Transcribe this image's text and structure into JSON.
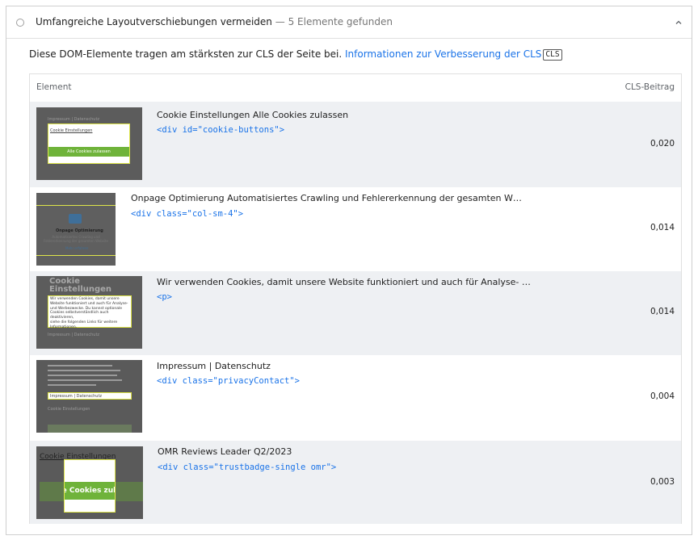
{
  "header": {
    "title": "Umfangreiche Layoutverschiebungen vermeiden",
    "separator": "—",
    "count": "5 Elemente gefunden"
  },
  "description": {
    "text": "Diese DOM-Elemente tragen am stärksten zur CLS der Seite bei.",
    "link": "Informationen zur Verbesserung der CLS",
    "badge": "CLS"
  },
  "table": {
    "col_element": "Element",
    "col_cls": "CLS-Beitrag",
    "rows": [
      {
        "label": "Cookie Einstellungen Alle Cookies zulassen",
        "snippet": "<div id=\"cookie-buttons\">",
        "value": "0,020",
        "thumb": {
          "text1": "Impressum | Datenschutz",
          "text2": "Cookie Einstellungen",
          "button": "Alle Cookies zulassen"
        }
      },
      {
        "label": "Onpage Optimierung Automatisiertes Crawling und Fehlererkennung der gesamten W…",
        "snippet": "<div class=\"col-sm-4\">",
        "value": "0,014",
        "thumb": {
          "text1": "Onpage Optimierung",
          "text2": "Automatisiertes Crawling und Fehlererkennung der gesamten Website",
          "link": "Mehr erfahren"
        }
      },
      {
        "label": "Wir verwenden Cookies, damit unsere Website funktioniert und auch für Analyse- …",
        "snippet": "<p>",
        "value": "0,014",
        "thumb": {
          "heading": "Cookie Einstellungen",
          "body": [
            "Wir verwenden Cookies, damit unsere",
            "Website funktioniert und auch für Analyse-",
            "und Werbezwecke. Du kannst optionale",
            "Cookies selbstverständlich auch deaktivieren,",
            "siehe die folgenden Links für weitere",
            "Informationen."
          ],
          "footer": "Impressum | Datenschutz"
        }
      },
      {
        "label": "Impressum | Datenschutz",
        "snippet": "<div class=\"privacyContact\">",
        "value": "0,004",
        "thumb": {
          "text1": "Impressum | Datenschutz",
          "text2": "Cookie Einstellungen"
        }
      },
      {
        "label": "OMR Reviews Leader Q2/2023",
        "snippet": "<div class=\"trustbadge-single omr\">",
        "value": "0,003",
        "thumb": {
          "text1": "Cookie Einstellungen",
          "button": "Alle Cookies zulassen"
        }
      }
    ]
  },
  "colors": {
    "accent": "#1a73e8",
    "row_shade": "#eef0f3",
    "highlight": "#dfe64a",
    "cookie_green": "#6fb33a"
  }
}
